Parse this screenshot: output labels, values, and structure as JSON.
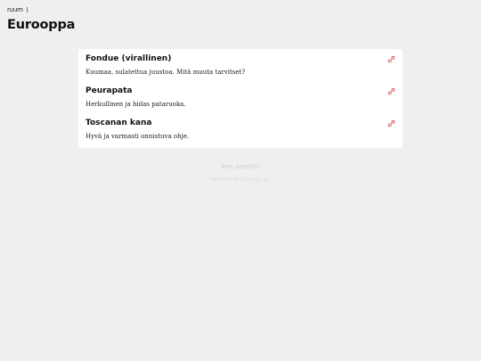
{
  "header": {
    "logo": "ruum",
    "title": "Eurooppa"
  },
  "recipes": [
    {
      "title": "Fondue (virallinen)",
      "description": "Kuumaa, sulatettua juustoa. Mitä muuta tarvitset?",
      "icon": "link-icon"
    },
    {
      "title": "Peurapata",
      "description": "Herkullinen ja hidas pataruoka.",
      "icon": "link-icon"
    },
    {
      "title": "Toscanan kana",
      "description": "Hyvä ja varmasti onnistuva ohje.",
      "icon": "link-icon"
    }
  ],
  "footer": {
    "sign_off": "Bon appetit!",
    "updated": "PÄIVITETTY 2024-05-30"
  },
  "colors": {
    "background": "#efefef",
    "card": "#ffffff",
    "accent": "#d9534f"
  }
}
